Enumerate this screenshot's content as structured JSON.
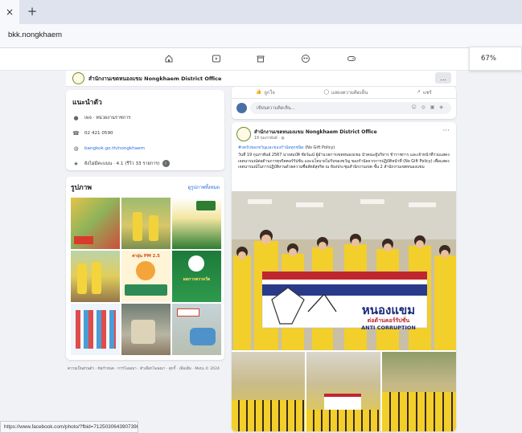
{
  "browser": {
    "tab_close": "×",
    "new_tab": "+",
    "url": "bkk.nongkhaem",
    "zoom": "67%",
    "status_url": "https://www.facebook.com/photo/?fbid=7125030643907398&set=pcb.7125030643907398&__"
  },
  "page": {
    "name": "สำนักงานเขตหนองแขม Nongkhaem District Office",
    "more_label": "..."
  },
  "intro": {
    "title": "แนะนำตัว",
    "category": "เพจ · หน่วยงานราชการ",
    "phone": "02 421 0590",
    "website": "bangkok.go.th/nongkhaem",
    "rating": "ยังไม่มีคะแนน · 4.1 (รีวิว 33 รายการ)"
  },
  "photos": {
    "title": "รูปภาพ",
    "see_all": "ดูรูปภาพทั้งหมด",
    "tile_texts": [
      "",
      "",
      "",
      "",
      "ค่าฝุ่น PM 2.5",
      "ผลการตรวจวัด",
      "",
      "",
      ""
    ]
  },
  "footer": "ความเป็นส่วนตัว · ข้อกำหนด · การโฆษณา · ตัวเลือกโฆษณา · คุกกี้ · เพิ่มเติม · Meta © 2024",
  "composer": {
    "like": "ถูกใจ",
    "comment": "แสดงความคิดเห็น",
    "share": "แชร์",
    "placeholder": "เขียนความคิดเห็น...",
    "icons": "☺ ◎ ▣ ◈"
  },
  "post": {
    "author": "สำนักงานเขตหนองแขม Nongkhaem District Office",
    "date": "19 กุมภาพันธ์ · ",
    "hashtag": "#งดรับของขวัญและของกำนัลทุกชนิด",
    "policy": " (No Gift Policy)",
    "body": "วันที่ 19 กุมภาพันธ์ 2567 นางสมบัติ ชัยวัฒน์ ผู้อำนวยการเขตหนองแขม นำคณะผู้บริหาร ข้าราชการ และเจ้าหน้าที่ร่วมแสดงเจตนารมณ์ต่อต้านการทุจริตคอร์รัปชั่น และนโยบายไม่รับของขวัญ ของกำนัลจากการปฏิบัติหน้าที่ (No Gift Policy) เพื่อแสดงเจตนารมณ์ในการปฏิบัติงานด้วยความซื่อสัตย์สุจริต ณ ห้องประชุมสำนักงานเขต ชั้น 2 สำนักงานเขตหนองแขม",
    "banner_main": "หนองแขม",
    "banner_sub": "ต่อต้านคอร์รัปชั่น",
    "banner_en": "ANTI CORRUPTION"
  }
}
